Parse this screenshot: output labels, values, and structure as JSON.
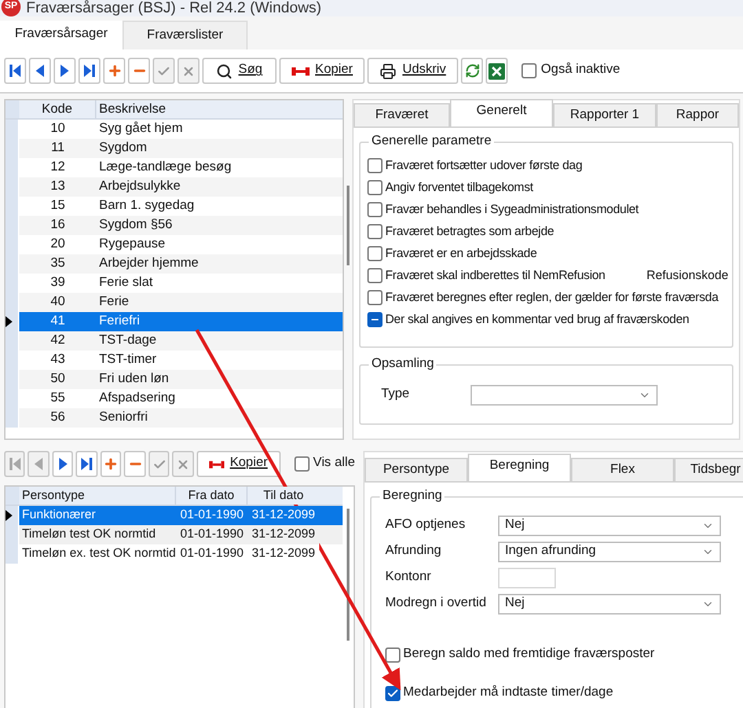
{
  "window": {
    "logo": "SP",
    "title": "Fraværsårsager (BSJ) - Rel 24.2 (Windows)"
  },
  "main_tabs": [
    {
      "label": "Fraværsårsager",
      "selected": true
    },
    {
      "label": "Fraværslister",
      "selected": false
    }
  ],
  "toolbar": {
    "buttons": [
      {
        "kind": "first",
        "disabled": false
      },
      {
        "kind": "prev",
        "disabled": false
      },
      {
        "kind": "next",
        "disabled": false
      },
      {
        "kind": "last",
        "disabled": false
      },
      {
        "kind": "add",
        "disabled": false
      },
      {
        "kind": "remove",
        "disabled": false
      },
      {
        "kind": "confirm",
        "disabled": true
      },
      {
        "kind": "cancel",
        "disabled": true
      },
      {
        "kind": "search",
        "label": "Søg",
        "disabled": false
      },
      {
        "kind": "copy",
        "label": "Kopier",
        "disabled": false
      },
      {
        "kind": "print",
        "label": "Udskriv",
        "disabled": false
      },
      {
        "kind": "refresh",
        "disabled": false
      },
      {
        "kind": "excel",
        "disabled": false
      }
    ],
    "checkbox": {
      "label": "Også inaktive",
      "checked": false
    }
  },
  "causes_table": {
    "columns": [
      "Kode",
      "Beskrivelse"
    ],
    "rows": [
      {
        "code": "10",
        "description": "Syg gået hjem",
        "selected": false
      },
      {
        "code": "11",
        "description": "Sygdom",
        "selected": false
      },
      {
        "code": "12",
        "description": "Læge-tandlæge besøg",
        "selected": false
      },
      {
        "code": "13",
        "description": "Arbejdsulykke",
        "selected": false
      },
      {
        "code": "15",
        "description": "Barn 1. sygedag",
        "selected": false
      },
      {
        "code": "16",
        "description": "Sygdom §56",
        "selected": false
      },
      {
        "code": "20",
        "description": "Rygepause",
        "selected": false
      },
      {
        "code": "35",
        "description": "Arbejder hjemme",
        "selected": false
      },
      {
        "code": "39",
        "description": "Ferie slat",
        "selected": false
      },
      {
        "code": "40",
        "description": "Ferie",
        "selected": false
      },
      {
        "code": "41",
        "description": "Feriefri",
        "selected": true
      },
      {
        "code": "42",
        "description": "TST-dage",
        "selected": false
      },
      {
        "code": "43",
        "description": "TST-timer",
        "selected": false
      },
      {
        "code": "50",
        "description": "Fri uden løn",
        "selected": false
      },
      {
        "code": "55",
        "description": "Afspadsering",
        "selected": false
      },
      {
        "code": "56",
        "description": "Seniorfri",
        "selected": false
      }
    ]
  },
  "detail_tabs": [
    {
      "label": "Fraværet",
      "selected": false
    },
    {
      "label": "Generelt",
      "selected": true
    },
    {
      "label": "Rapporter 1",
      "selected": false
    },
    {
      "label": "Rappor",
      "selected": false
    }
  ],
  "general_group": {
    "title": "Generelle parametre",
    "options": [
      {
        "label": "Fraværet fortsætter udover første dag",
        "checked": false,
        "indeterminate": false
      },
      {
        "label": "Angiv forventet tilbagekomst",
        "checked": false,
        "indeterminate": false
      },
      {
        "label": "Fravær behandles i Sygeadministrationsmodulet",
        "checked": false,
        "indeterminate": false
      },
      {
        "label": "Fraværet betragtes som arbejde",
        "checked": false,
        "indeterminate": false
      },
      {
        "label": "Fraværet er en arbejdsskade",
        "checked": false,
        "indeterminate": false
      },
      {
        "label": "Fraværet skal indberettes til NemRefusion",
        "checked": false,
        "indeterminate": false,
        "extra_label": "Refusionskode"
      },
      {
        "label": "Fraværet beregnes efter reglen, der gælder for første fraværsda",
        "checked": false,
        "indeterminate": false
      },
      {
        "label": "Der skal angives en kommentar ved brug af fraværskoden",
        "checked": true,
        "indeterminate": true
      }
    ]
  },
  "collection_group": {
    "title": "Opsamling",
    "type_label": "Type"
  },
  "sub_toolbar": {
    "buttons": [
      {
        "kind": "first",
        "disabled": true
      },
      {
        "kind": "prev",
        "disabled": true
      },
      {
        "kind": "next",
        "disabled": false
      },
      {
        "kind": "last",
        "disabled": false
      },
      {
        "kind": "add",
        "disabled": false
      },
      {
        "kind": "remove",
        "disabled": false
      },
      {
        "kind": "confirm",
        "disabled": true
      },
      {
        "kind": "cancel",
        "disabled": true
      },
      {
        "kind": "copy",
        "label": "Kopier",
        "disabled": false
      }
    ],
    "checkbox": {
      "label": "Vis alle",
      "checked": false
    }
  },
  "persontype_table": {
    "columns": [
      "Persontype",
      "Fra dato",
      "Til dato"
    ],
    "rows": [
      {
        "persontype": "Funktionærer",
        "from": "01-01-1990",
        "to": "31-12-2099",
        "selected": true
      },
      {
        "persontype": "Timeløn test OK normtid",
        "from": "01-01-1990",
        "to": "31-12-2099",
        "selected": false
      },
      {
        "persontype": "Timeløn ex. test OK normtid",
        "from": "01-01-1990",
        "to": "31-12-2099",
        "selected": false
      }
    ]
  },
  "calc_tabs": [
    {
      "label": "Persontype",
      "selected": false
    },
    {
      "label": "Beregning",
      "selected": true
    },
    {
      "label": "Flex",
      "selected": false
    },
    {
      "label": "Tidsbegr",
      "selected": false
    }
  ],
  "calc_group": {
    "title": "Beregning",
    "fields": [
      {
        "label": "AFO optjenes",
        "kind": "select",
        "value": "Nej"
      },
      {
        "label": "Afrunding",
        "kind": "select",
        "value": "Ingen afrunding"
      },
      {
        "label": "Kontonr",
        "kind": "input"
      },
      {
        "label": "Modregn i overtid",
        "kind": "select",
        "value": "Nej"
      }
    ],
    "options": [
      {
        "label": "Beregn saldo med fremtidige fraværsposter",
        "checked": false
      },
      {
        "label": "Medarbejder må indtaste timer/dage",
        "checked": true
      }
    ]
  }
}
